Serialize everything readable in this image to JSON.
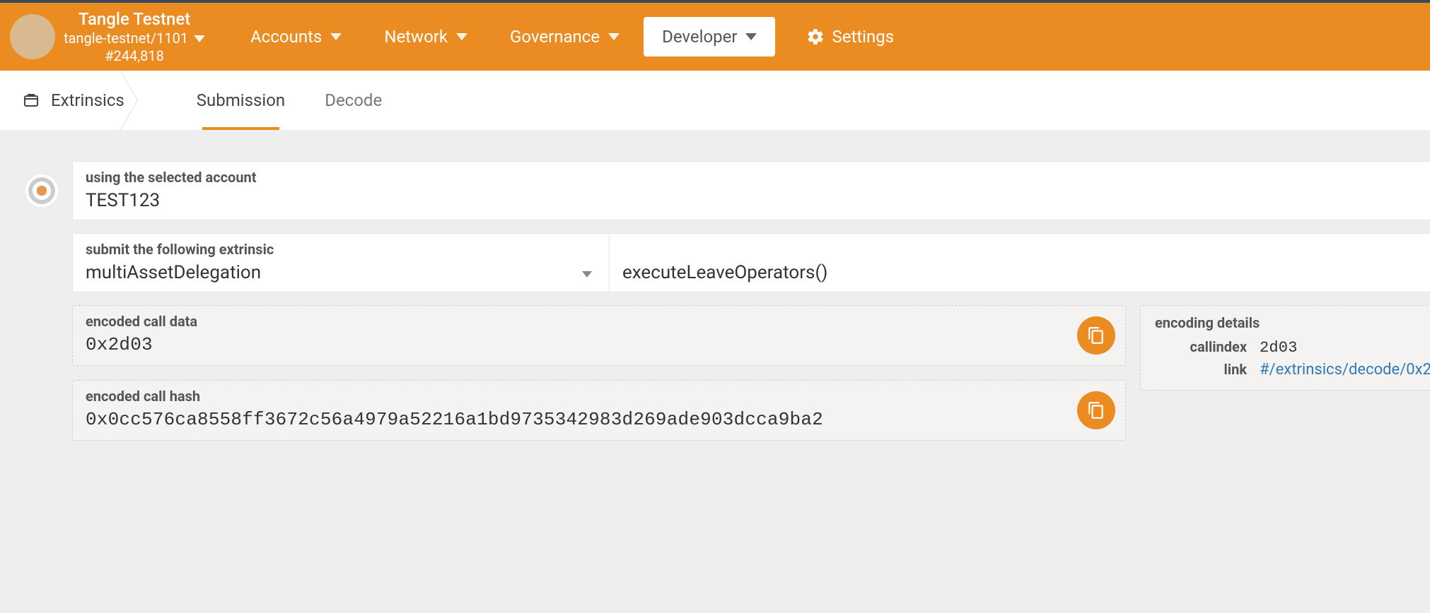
{
  "network": {
    "name": "Tangle Testnet",
    "spec": "tangle-testnet/1101",
    "block": "#244,818"
  },
  "nav": {
    "items": [
      {
        "label": "Accounts",
        "hasCaret": true
      },
      {
        "label": "Network",
        "hasCaret": true
      },
      {
        "label": "Governance",
        "hasCaret": true
      },
      {
        "label": "Developer",
        "hasCaret": true,
        "active": true
      }
    ],
    "settings_label": "Settings"
  },
  "subnav": {
    "root": "Extrinsics",
    "tabs": [
      {
        "label": "Submission",
        "active": true
      },
      {
        "label": "Decode"
      }
    ]
  },
  "account": {
    "label": "using the selected account",
    "name": "TEST123"
  },
  "extrinsic": {
    "label": "submit the following extrinsic",
    "pallet": "multiAssetDelegation",
    "call": "executeLeaveOperators()"
  },
  "encoded": {
    "call_data_label": "encoded call data",
    "call_data": "0x2d03",
    "call_hash_label": "encoded call hash",
    "call_hash": "0x0cc576ca8558ff3672c56a4979a52216a1bd9735342983d269ade903dcca9ba2"
  },
  "details": {
    "title": "encoding details",
    "callindex_label": "callindex",
    "callindex": "2d03",
    "link_label": "link",
    "link": "#/extrinsics/decode/0x2"
  }
}
